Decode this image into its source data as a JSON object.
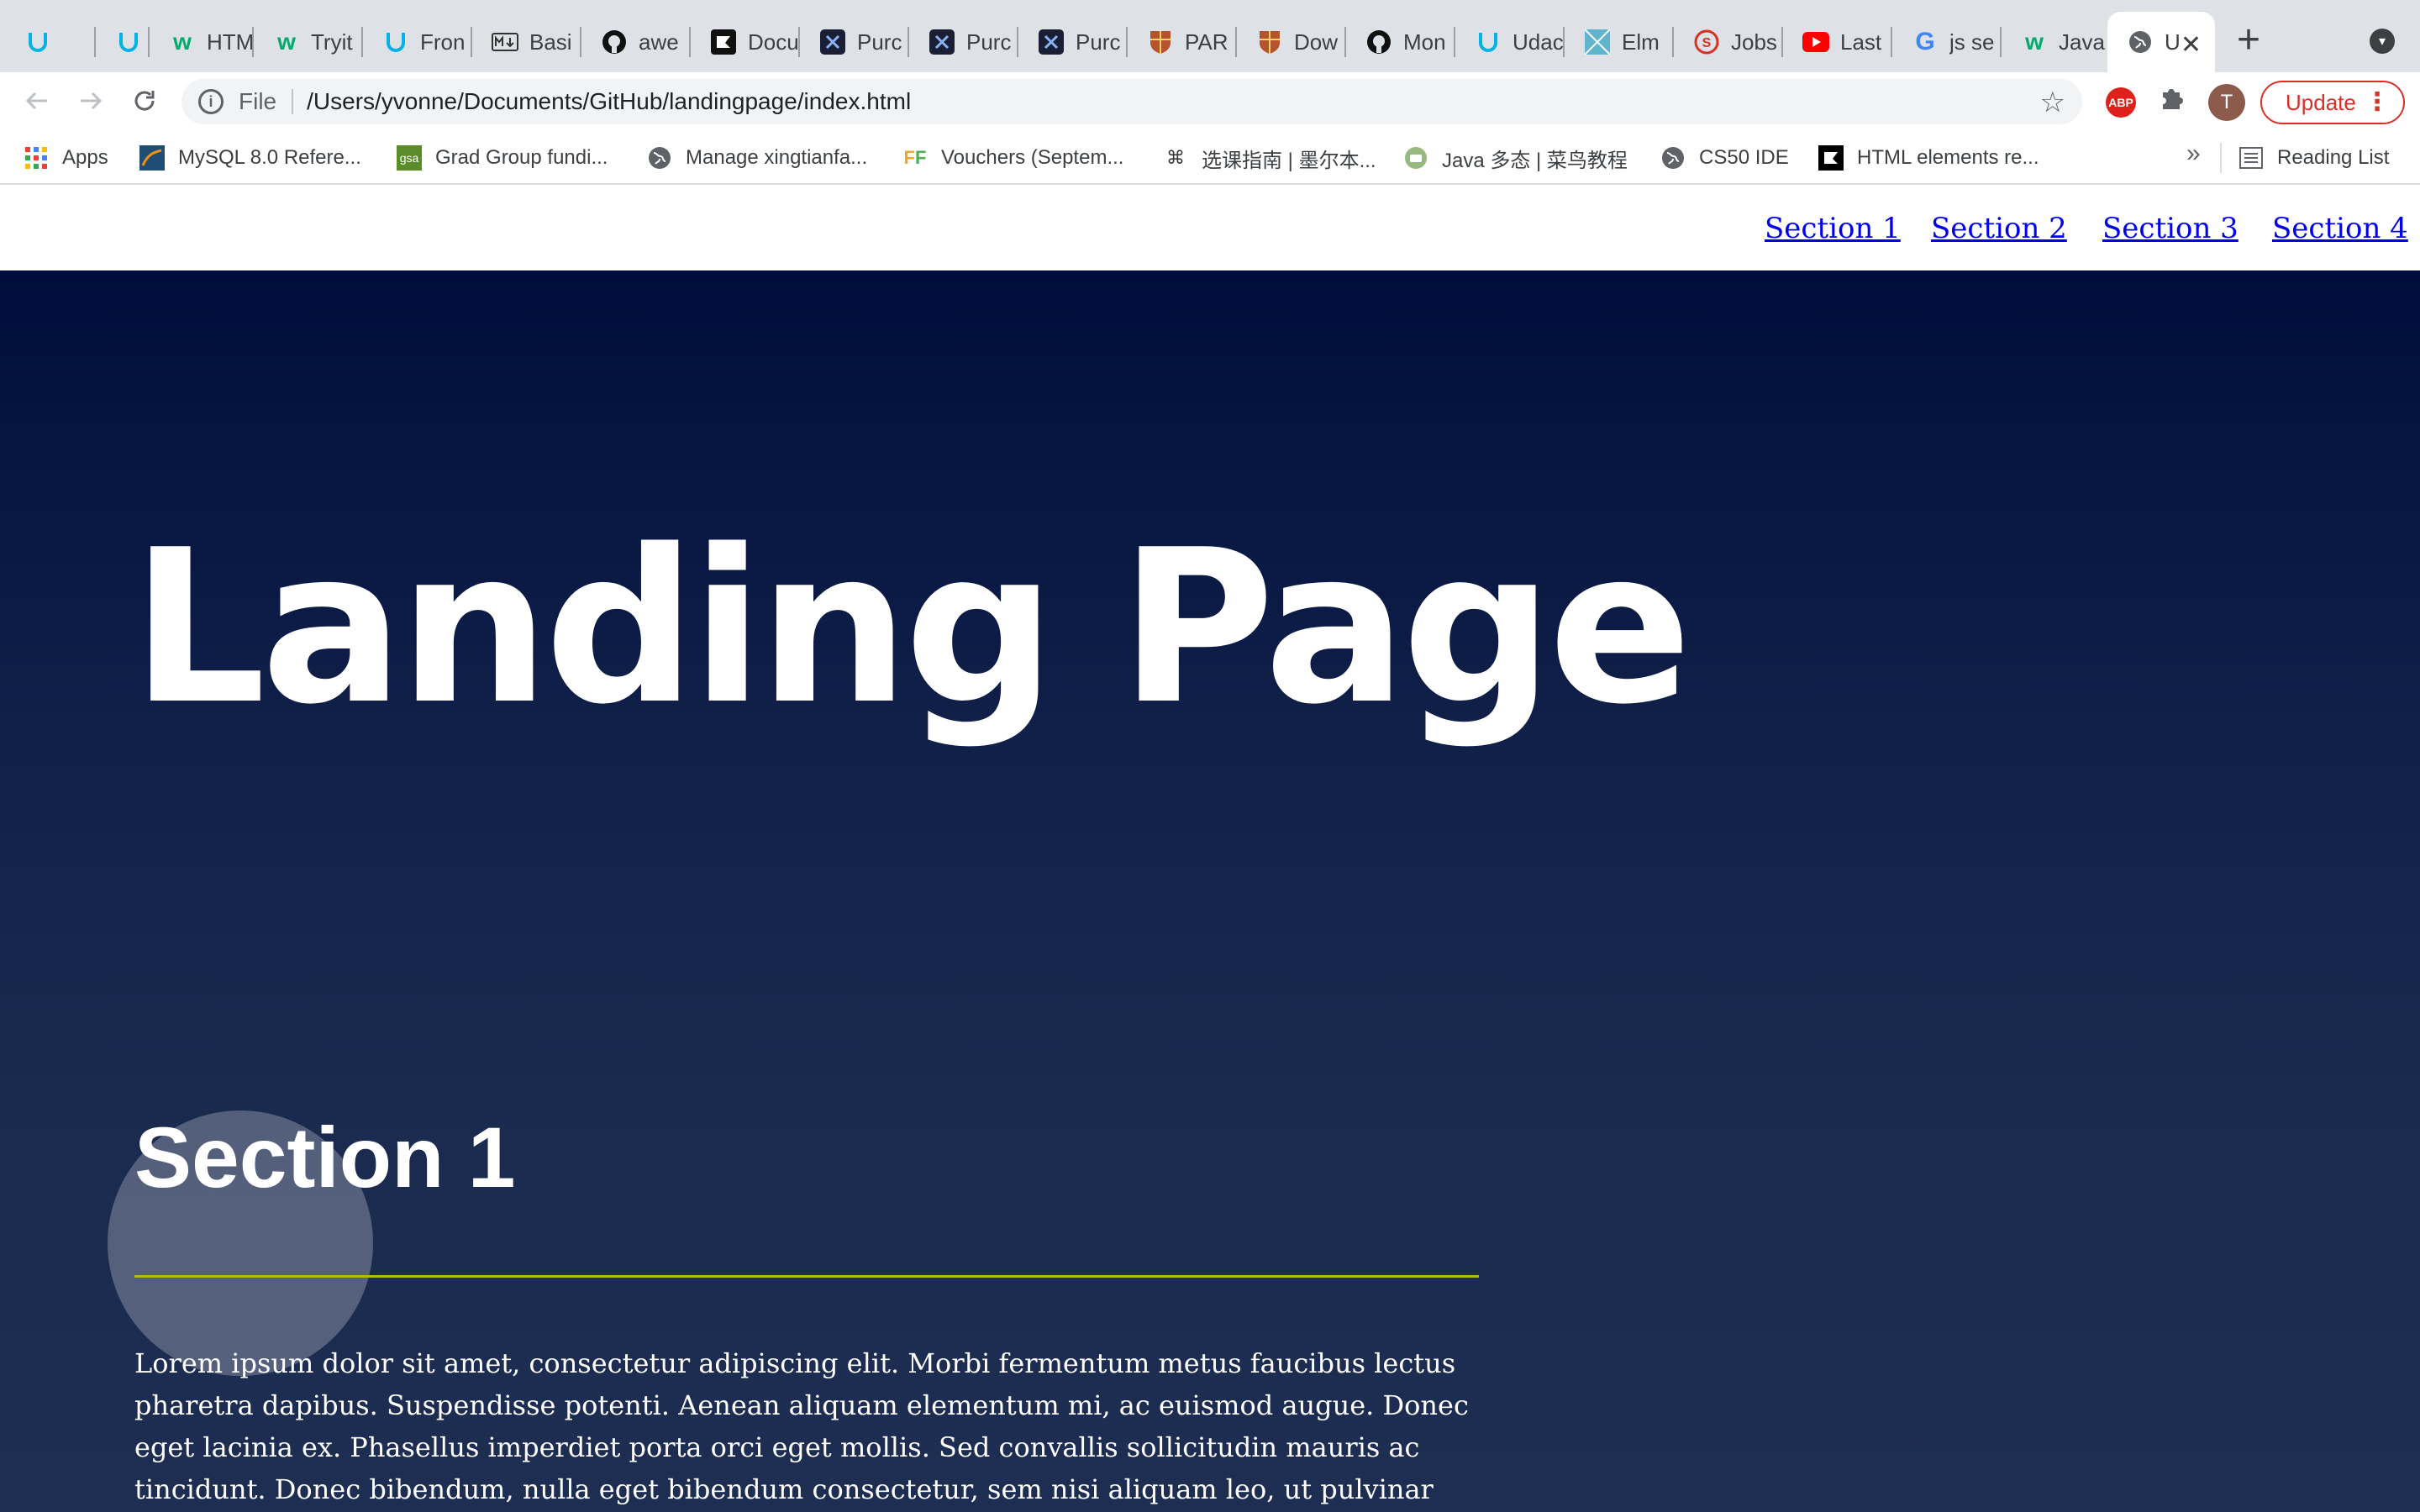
{
  "browser": {
    "tabs": [
      {
        "title": "",
        "icon": "udacity-icon"
      },
      {
        "title": "",
        "icon": "udacity-icon"
      },
      {
        "title": "HTM",
        "icon": "w3schools-icon"
      },
      {
        "title": "Tryit",
        "icon": "w3schools-icon"
      },
      {
        "title": "Fron",
        "icon": "udacity-icon"
      },
      {
        "title": "Basi",
        "icon": "markdown-icon"
      },
      {
        "title": "awe",
        "icon": "github-icon"
      },
      {
        "title": "Docu",
        "icon": "devdocs-icon"
      },
      {
        "title": "Purc",
        "icon": "purchase-icon"
      },
      {
        "title": "Purc",
        "icon": "purchase-icon"
      },
      {
        "title": "Purc",
        "icon": "purchase-icon"
      },
      {
        "title": "PAR",
        "icon": "shield-crest-icon"
      },
      {
        "title": "Dow",
        "icon": "shield-crest-icon"
      },
      {
        "title": "Mon",
        "icon": "github-icon"
      },
      {
        "title": "Udac",
        "icon": "udacity-icon"
      },
      {
        "title": "Elm",
        "icon": "elm-icon"
      },
      {
        "title": "Jobs",
        "icon": "s-circle-icon"
      },
      {
        "title": "Last",
        "icon": "youtube-icon"
      },
      {
        "title": "js se",
        "icon": "google-icon"
      },
      {
        "title": "Java",
        "icon": "w3schools-icon"
      },
      {
        "title": "U",
        "icon": "globe-icon"
      }
    ],
    "new_tab_label": "+",
    "tab_close_label": "✕",
    "address": {
      "scheme_label": "File",
      "url": "/Users/yvonne/Documents/GitHub/landingpage/index.html"
    },
    "avatar_letter": "T",
    "update_label": "Update",
    "bookmarks": [
      {
        "label": "Apps",
        "icon": "apps-grid-icon"
      },
      {
        "label": "MySQL 8.0 Refere...",
        "icon": "mysql-icon"
      },
      {
        "label": "Grad Group fundi...",
        "icon": "gsa-icon"
      },
      {
        "label": "Manage xingtianfa...",
        "icon": "globe-icon"
      },
      {
        "label": "Vouchers (Septem...",
        "icon": "ff-icon"
      },
      {
        "label": "选课指南 | 墨尔本...",
        "icon": "course-icon"
      },
      {
        "label": "Java 多态 | 菜鸟教程",
        "icon": "runoob-icon"
      },
      {
        "label": "CS50 IDE",
        "icon": "globe-icon"
      },
      {
        "label": "HTML elements re...",
        "icon": "mdn-icon"
      }
    ],
    "bookmarks_more": "»",
    "reading_list_label": "Reading List"
  },
  "page": {
    "nav": [
      "Section 1",
      "Section 2",
      "Section 3",
      "Section 4"
    ],
    "hero_title": "Landing Page",
    "section1": {
      "title": "Section 1",
      "body": "Lorem ipsum dolor sit amet, consectetur adipiscing elit. Morbi fermentum metus faucibus lectus pharetra dapibus. Suspendisse potenti. Aenean aliquam elementum mi, ac euismod augue. Donec eget lacinia ex. Phasellus imperdiet porta orci eget mollis. Sed convallis sollicitudin mauris ac tincidunt. Donec bibendum, nulla eget bibendum consectetur, sem nisi aliquam leo, ut pulvinar quam nunc eu"
    }
  },
  "colors": {
    "hero_top": "#000d3c",
    "hero_bottom": "#1e2d52",
    "section_rule": "#b3b81c",
    "nav_link": "#0000ee",
    "update_red": "#d93025"
  }
}
